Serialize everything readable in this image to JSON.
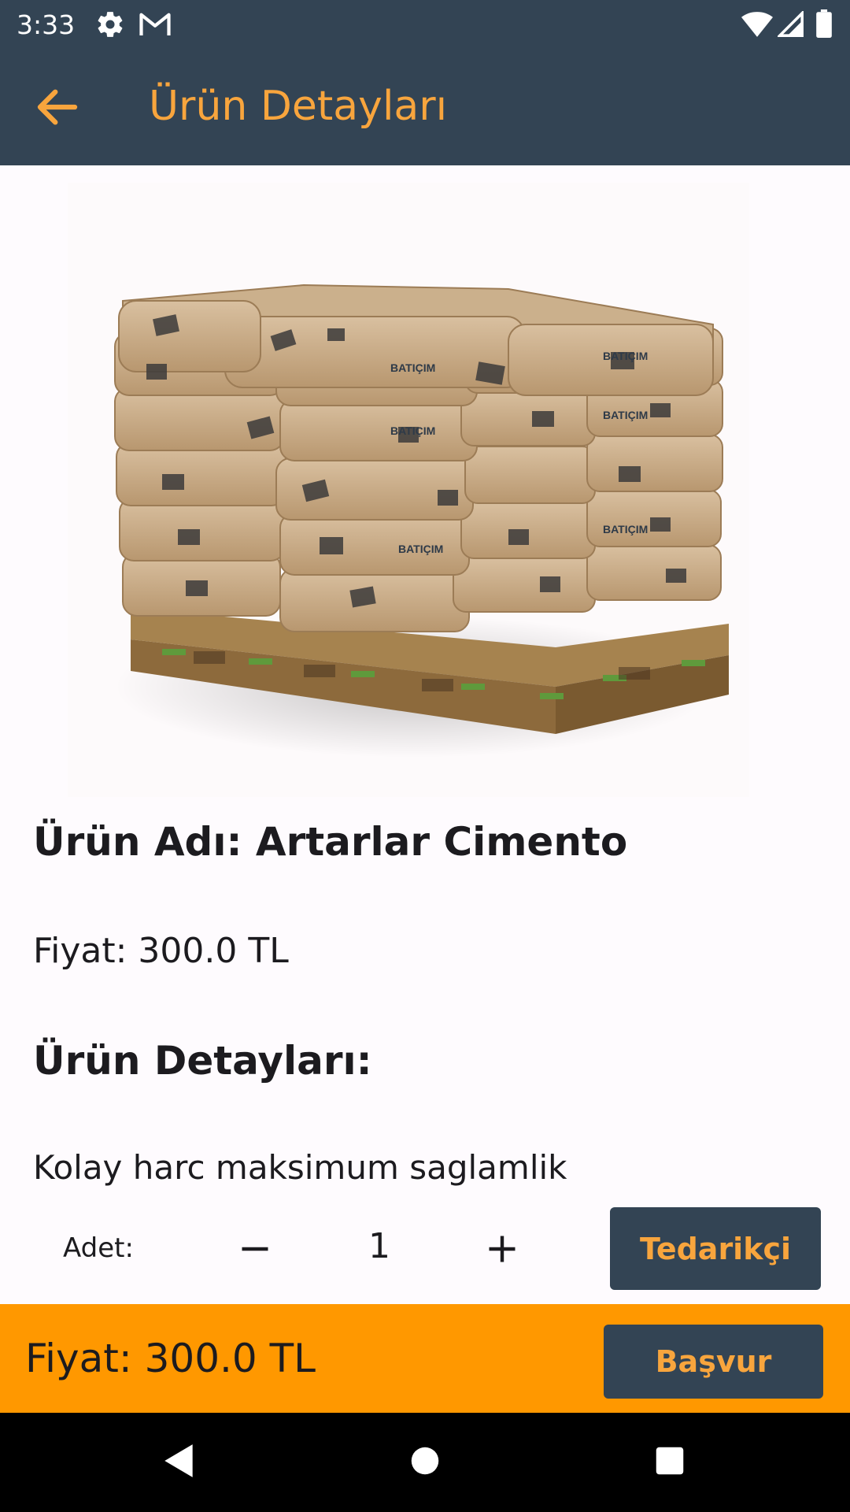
{
  "status_bar": {
    "time": "3:33",
    "icons": [
      "settings-icon",
      "gmail-icon",
      "wifi-icon",
      "signal-icon",
      "battery-icon"
    ]
  },
  "app_bar": {
    "title": "Ürün Detayları",
    "back_icon": "arrow-back-icon"
  },
  "product": {
    "image": "cement-bags-on-pallet",
    "brand_on_bags": "BATIÇIM",
    "name": "Ürün Adı: Artarlar Cimento",
    "price": "Fiyat: 300.0 TL",
    "details_heading": "Ürün Detayları:",
    "details_text": "Kolay harc maksimum saglamlik"
  },
  "quantity": {
    "label": "Adet:",
    "value": "1",
    "minus_icon": "minus-icon",
    "plus_icon": "plus-icon"
  },
  "supplier_button": {
    "label": "Tedarikçi"
  },
  "bottom_bar": {
    "price": "Fiyat: 300.0 TL",
    "apply_label": "Başvur"
  },
  "colors": {
    "primary_dark": "#334454",
    "accent": "#f8a53d",
    "bottom_bar": "#ff9800",
    "background": "#fefbfe"
  }
}
